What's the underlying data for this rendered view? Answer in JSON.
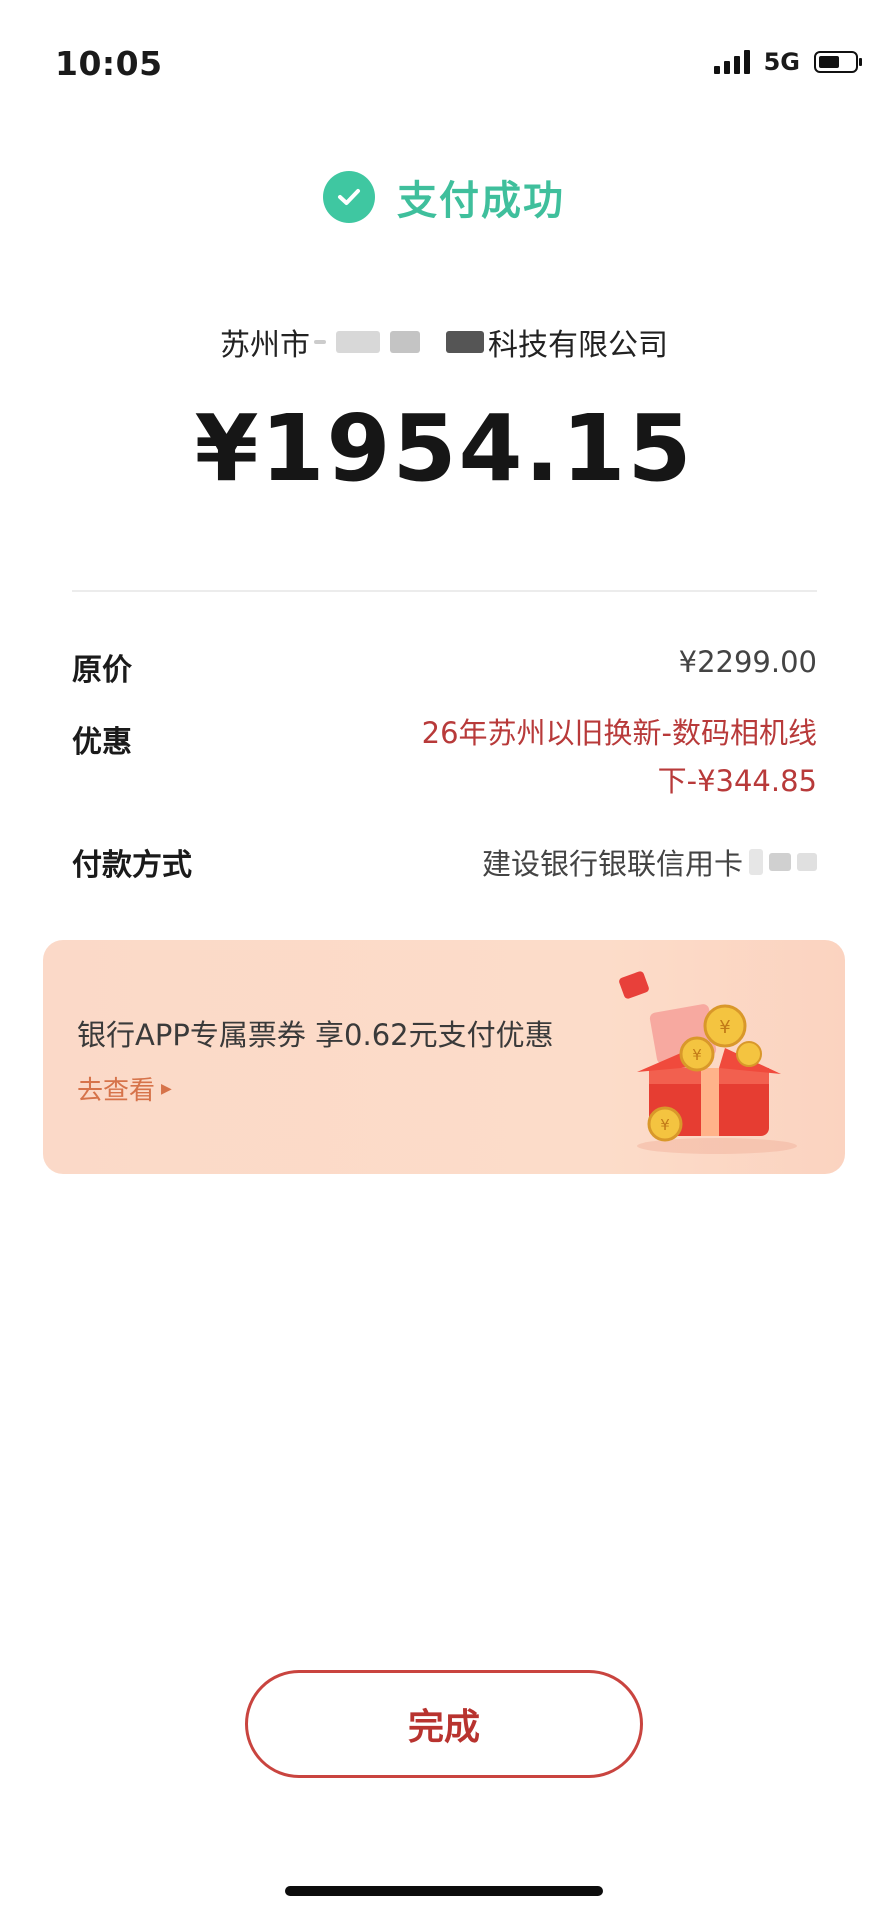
{
  "status_bar": {
    "time": "10:05",
    "network": "5G",
    "battery_level": 0.6,
    "signal_bars": 4
  },
  "header": {
    "success_text": "支付成功"
  },
  "merchant": {
    "prefix": "苏州市",
    "suffix": "科技有限公司"
  },
  "payment": {
    "amount": "¥1954.15"
  },
  "details": {
    "original_label": "原价",
    "original_value": "¥2299.00",
    "discount_label": "优惠",
    "discount_line1": "26年苏州以旧换新-数码相机线",
    "discount_line2": "下-¥344.85",
    "method_label": "付款方式",
    "method_value": "建设银行银联信用卡"
  },
  "banner": {
    "title": "银行APP专属票券 享0.62元支付优惠",
    "link": "去查看"
  },
  "done_button": "完成",
  "colors": {
    "success": "#3fbf9c",
    "accent_red": "#b8332f",
    "banner_bg": "#fcdcc9"
  }
}
